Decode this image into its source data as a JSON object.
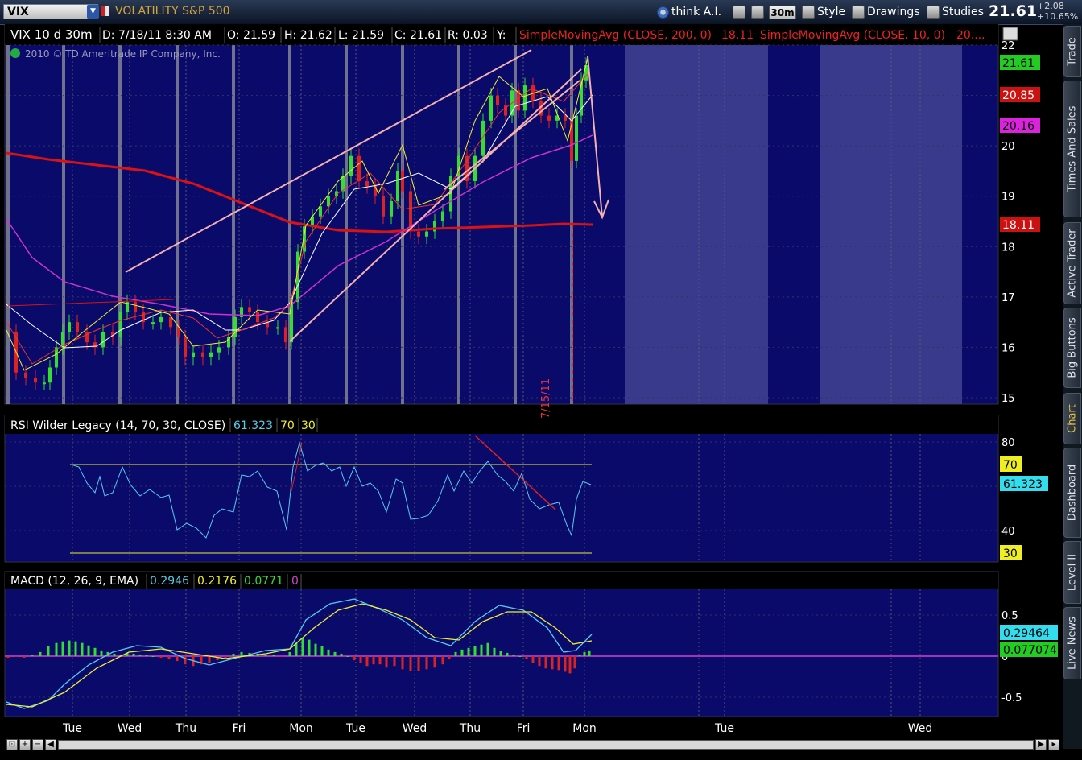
{
  "toolbar": {
    "symbol": "VIX",
    "description": "VOLATILITY S&P 500",
    "think_label": "think A.I.",
    "period": "30m",
    "style_label": "Style",
    "drawings_label": "Drawings",
    "studies_label": "Studies",
    "last_price": "21.61",
    "change": "+2.08",
    "change_pct": "+10.65%"
  },
  "side_tabs": [
    "Trade",
    "Times And Sales",
    "Active Trader",
    "Big Buttons",
    "Chart",
    "Dashboard",
    "Level II",
    "Live News"
  ],
  "active_side_tab": "Chart",
  "price_panel": {
    "header": {
      "title": "VIX 10 d 30m",
      "date": "D: 7/18/11 8:30 AM",
      "open": "O: 21.59",
      "high": "H: 21.62",
      "low": "L: 21.59",
      "close": "C: 21.61",
      "range": "R: 0.03",
      "y": "Y:",
      "sma200": "SimpleMovingAvg (CLOSE, 200, 0)",
      "sma200_val": "18.11",
      "sma10": "SimpleMovingAvg (CLOSE, 10, 0)",
      "sma10_val": "20...."
    },
    "copyright": "2010 © TD Ameritrade IP Company, Inc.",
    "axis_labels": [
      "22",
      "21",
      "20",
      "19",
      "18",
      "17",
      "16",
      "15"
    ],
    "badges": [
      {
        "text": "21.61",
        "color": "#22cc22",
        "fg": "#000000"
      },
      {
        "text": "20.85",
        "color": "#cc1111",
        "fg": "#ffffff"
      },
      {
        "text": "20.16",
        "color": "#dd22dd",
        "fg": "#000000"
      },
      {
        "text": "18.11",
        "color": "#cc1111",
        "fg": "#ffffff"
      }
    ],
    "annotation": "7/15/11"
  },
  "rsi_panel": {
    "name": "RSI Wilder Legacy (14, 70, 30, CLOSE)",
    "value": "61.323",
    "ob": "70",
    "os": "30",
    "axis_labels": [
      "80",
      "60",
      "40"
    ],
    "badges": [
      {
        "text": "70",
        "color": "#eeee22",
        "fg": "#000000"
      },
      {
        "text": "61.323",
        "color": "#33ddee",
        "fg": "#000000"
      },
      {
        "text": "30",
        "color": "#eeee22",
        "fg": "#000000"
      }
    ]
  },
  "macd_panel": {
    "name": "MACD (12, 26, 9, EMA)",
    "v1": "0.2946",
    "v2": "0.2176",
    "v3": "0.0771",
    "v4": "0",
    "axis_labels": [
      "0.5",
      "0",
      "-0.5"
    ],
    "badges": [
      {
        "text": "0.29464",
        "color": "#33ddee",
        "fg": "#000000"
      },
      {
        "text": "0.077074",
        "color": "#22cc22",
        "fg": "#000000"
      }
    ]
  },
  "time_axis": [
    "Tue",
    "Wed",
    "Thu",
    "Fri",
    "Mon",
    "Tue",
    "Wed",
    "Thu",
    "Fri",
    "Mon",
    "Tue",
    "Wed"
  ],
  "colors": {
    "plot_bg": "#0a0a6a",
    "session_bg": "#3a3a8c",
    "up_candle": "#33dd33",
    "down_candle": "#dd2222",
    "sma200": "#dd1111",
    "trend": "#f4b0b0",
    "rsi": "#55ccee",
    "macd": "#55ccee",
    "signal": "#eeee33"
  }
}
